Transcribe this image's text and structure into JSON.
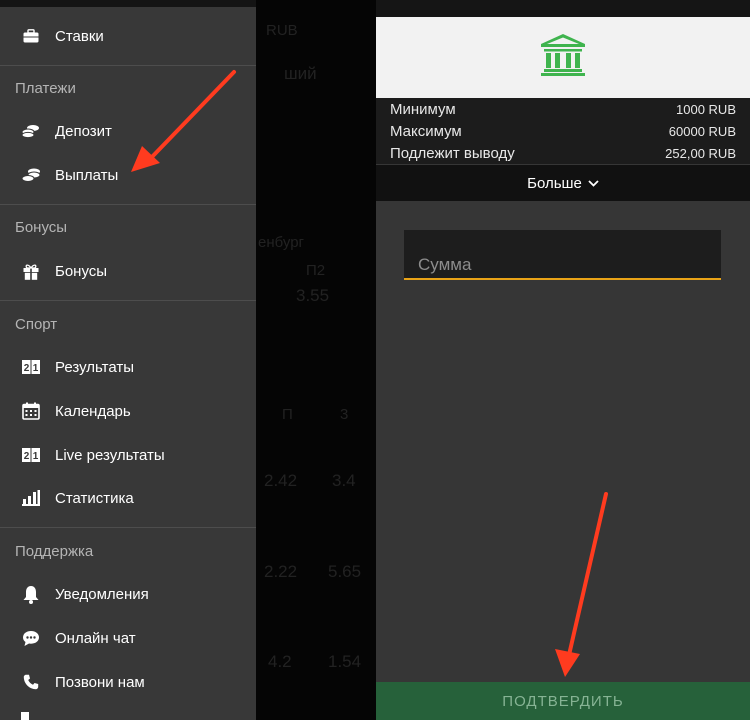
{
  "drawer": {
    "top_item": {
      "label": "Ставки",
      "icon": "briefcase-icon"
    },
    "sections": [
      {
        "title": "Платежи",
        "items": [
          {
            "label": "Депозит",
            "icon": "coins-icon"
          },
          {
            "label": "Выплаты",
            "icon": "coins-stack-icon"
          }
        ]
      },
      {
        "title": "Бонусы",
        "items": [
          {
            "label": "Бонусы",
            "icon": "gift-icon"
          }
        ]
      },
      {
        "title": "Спорт",
        "items": [
          {
            "label": "Результаты",
            "icon": "scoreboard-icon"
          },
          {
            "label": "Календарь",
            "icon": "calendar-icon"
          },
          {
            "label": "Live результаты",
            "icon": "scoreboard-icon"
          },
          {
            "label": "Статистика",
            "icon": "bar-chart-icon"
          }
        ]
      },
      {
        "title": "Поддержка",
        "items": [
          {
            "label": "Уведомления",
            "icon": "bell-icon"
          },
          {
            "label": "Онлайн чат",
            "icon": "chat-icon"
          },
          {
            "label": "Позвони нам",
            "icon": "phone-icon"
          }
        ]
      }
    ]
  },
  "background": {
    "fragments": [
      "RUB",
      "ший",
      "енбург",
      "П2",
      "3.55",
      "П",
      "3",
      "2.42",
      "3.4",
      "2.22",
      "5.65",
      "4.2",
      "1.54"
    ]
  },
  "panel": {
    "bank_icon": "bank-icon",
    "limits": [
      {
        "label": "Минимум",
        "value": "1000 RUB"
      },
      {
        "label": "Максимум",
        "value": "60000 RUB"
      },
      {
        "label": "Подлежит выводу",
        "value": "252,00 RUB"
      }
    ],
    "more_label": "Больше",
    "amount_placeholder": "Сумма",
    "confirm_label": "ПОДТВЕРДИТЬ"
  },
  "colors": {
    "accent_green": "#3fb44e",
    "input_underline": "#e8a317",
    "confirm_bg": "#26613a",
    "annotation_arrow": "#ff3b1f"
  }
}
